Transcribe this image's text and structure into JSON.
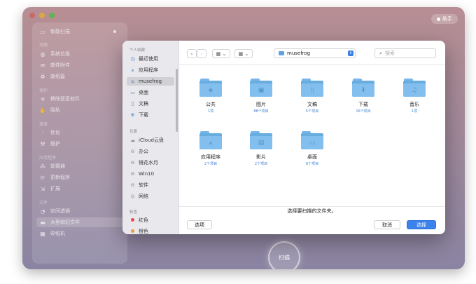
{
  "app": {
    "assistant_label": "助手",
    "scan_label": "扫描",
    "sidebar": {
      "top_item": "智能扫描",
      "sections": {
        "clean": "清理",
        "protect": "保护",
        "speed": "速度",
        "apps": "应用程序",
        "files": "文件"
      },
      "items": [
        {
          "label": "系统垃圾",
          "icon": "trash-can-icon"
        },
        {
          "label": "邮件附件",
          "icon": "mail-icon"
        },
        {
          "label": "废纸篓",
          "icon": "bin-icon"
        },
        {
          "label": "移除恶意软件",
          "icon": "biohazard-icon"
        },
        {
          "label": "隐私",
          "icon": "hand-icon"
        },
        {
          "label": "优化",
          "icon": "sliders-icon"
        },
        {
          "label": "维护",
          "icon": "wrench-icon"
        },
        {
          "label": "卸载器",
          "icon": "uninstall-icon"
        },
        {
          "label": "更新程序",
          "icon": "update-icon"
        },
        {
          "label": "扩展",
          "icon": "extension-icon"
        },
        {
          "label": "空间透镜",
          "icon": "lens-icon"
        },
        {
          "label": "大型和旧文件",
          "icon": "folder-icon"
        },
        {
          "label": "碎纸机",
          "icon": "shredder-icon"
        }
      ]
    }
  },
  "dialog": {
    "sidebar": {
      "favorites_title": "个人收藏",
      "favorites": [
        "最近使用",
        "应用程序",
        "musefrog",
        "桌面",
        "文稿",
        "下载"
      ],
      "locations_title": "位置",
      "locations": [
        "iCloud云盘",
        "办公",
        "镜花水月",
        "Win10",
        "软件",
        "网络"
      ],
      "tags_title": "标签",
      "tags": [
        {
          "label": "红色",
          "color": "#e5484d"
        },
        {
          "label": "橙色",
          "color": "#f29a38"
        }
      ]
    },
    "toolbar": {
      "back": "‹",
      "forward": "›",
      "view_grid": "▦ ⌄",
      "view_group": "▦ ⌄",
      "path": "musefrog",
      "search_placeholder": "搜索"
    },
    "folders": [
      {
        "name": "公共",
        "count": "1项",
        "emblem": "◈"
      },
      {
        "name": "图片",
        "count": "88个项目",
        "emblem": "▣"
      },
      {
        "name": "文稿",
        "count": "5个项目",
        "emblem": "▯"
      },
      {
        "name": "下载",
        "count": "16个项目",
        "emblem": "⬇"
      },
      {
        "name": "音乐",
        "count": "1项",
        "emblem": "♫"
      },
      {
        "name": "应用程序",
        "count": "2个项目",
        "emblem": "⩓"
      },
      {
        "name": "影片",
        "count": "2个项目",
        "emblem": "▤"
      },
      {
        "name": "桌面",
        "count": "8个项目",
        "emblem": "▭"
      }
    ],
    "prompt": "选择要扫描的文件夹。",
    "options_label": "选项",
    "cancel_label": "取消",
    "choose_label": "选择"
  }
}
